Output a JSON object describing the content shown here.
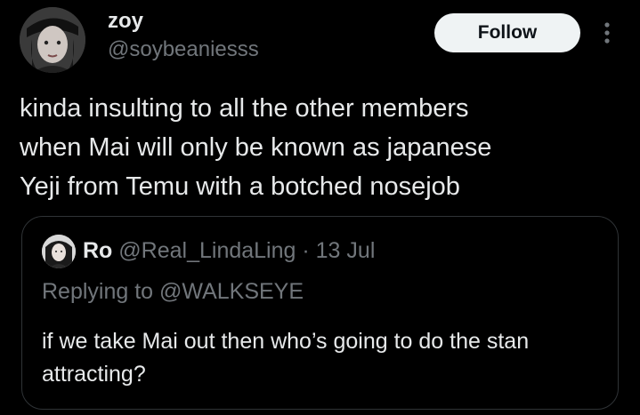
{
  "author": {
    "display_name": "zoy",
    "handle": "@soybeaniesss",
    "avatar_icon": "profile-photo"
  },
  "actions": {
    "follow_label": "Follow",
    "more_icon": "more-vertical-icon"
  },
  "tweet": {
    "lines": [
      "kinda insulting to all the other members",
      "when Mai will only be known as japanese",
      "Yeji from Temu with a botched nosejob"
    ]
  },
  "quoted": {
    "name": "Ro",
    "handle": "@Real_LindaLing",
    "separator": "·",
    "time": "13 Jul",
    "replying_to": "Replying to @WALKSEYE",
    "lines": [
      "if we take Mai out then who’s going to do the stan",
      "attracting?"
    ]
  },
  "colors": {
    "background": "#000000",
    "text": "#e7e9ea",
    "secondary": "#71767b",
    "border": "#2f3336",
    "button_bg": "#eff3f4"
  }
}
